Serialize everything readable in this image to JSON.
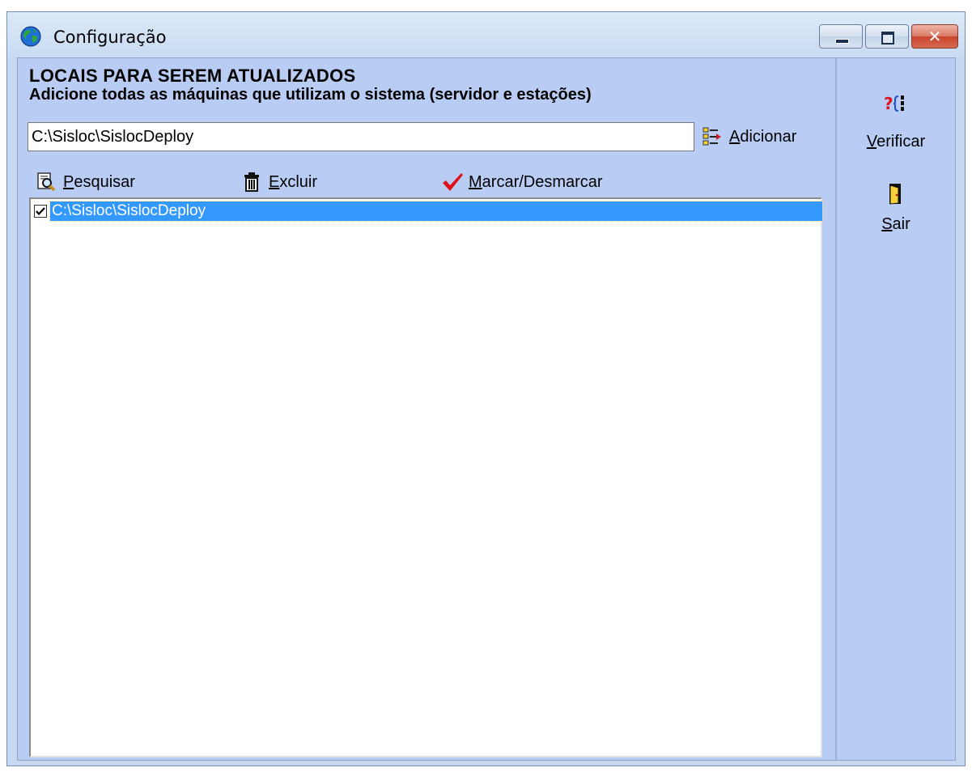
{
  "window": {
    "title": "Configuração",
    "app_icon": "globe-icon",
    "caption_buttons": [
      "minimize-icon",
      "maximize-icon",
      "close-icon"
    ],
    "close_glyph": "✕"
  },
  "main": {
    "heading": "LOCAIS PARA SEREM ATUALIZADOS",
    "subheading": "Adicione todas as máquinas que utilizam o sistema (servidor e estações)",
    "path_input": {
      "value": "C:\\Sisloc\\SislocDeploy"
    },
    "add_button": {
      "accel": "A",
      "rest": "dicionar",
      "icon": "add-list-icon"
    },
    "toolbar": {
      "search": {
        "accel": "P",
        "rest": "esquisar",
        "icon": "search-icon"
      },
      "delete": {
        "accel": "E",
        "rest": "xcluir",
        "icon": "trash-icon"
      },
      "mark": {
        "accel": "M",
        "rest": "arcar/Desmarcar",
        "icon": "checkmark-icon",
        "icon_color": "#e0101a"
      }
    },
    "list": {
      "items": [
        {
          "text": "C:\\Sisloc\\SislocDeploy",
          "checked": true,
          "selected": true
        }
      ],
      "selection_color": "#3399ff"
    }
  },
  "side": {
    "verify": {
      "accel": "V",
      "rest": "erificar",
      "icon": "verify-icon"
    },
    "exit": {
      "accel": "S",
      "rest": "air",
      "icon": "exit-door-icon"
    }
  },
  "colors": {
    "panel_bg": "#b9cdf4",
    "title_bg": "#c8dbf2"
  }
}
